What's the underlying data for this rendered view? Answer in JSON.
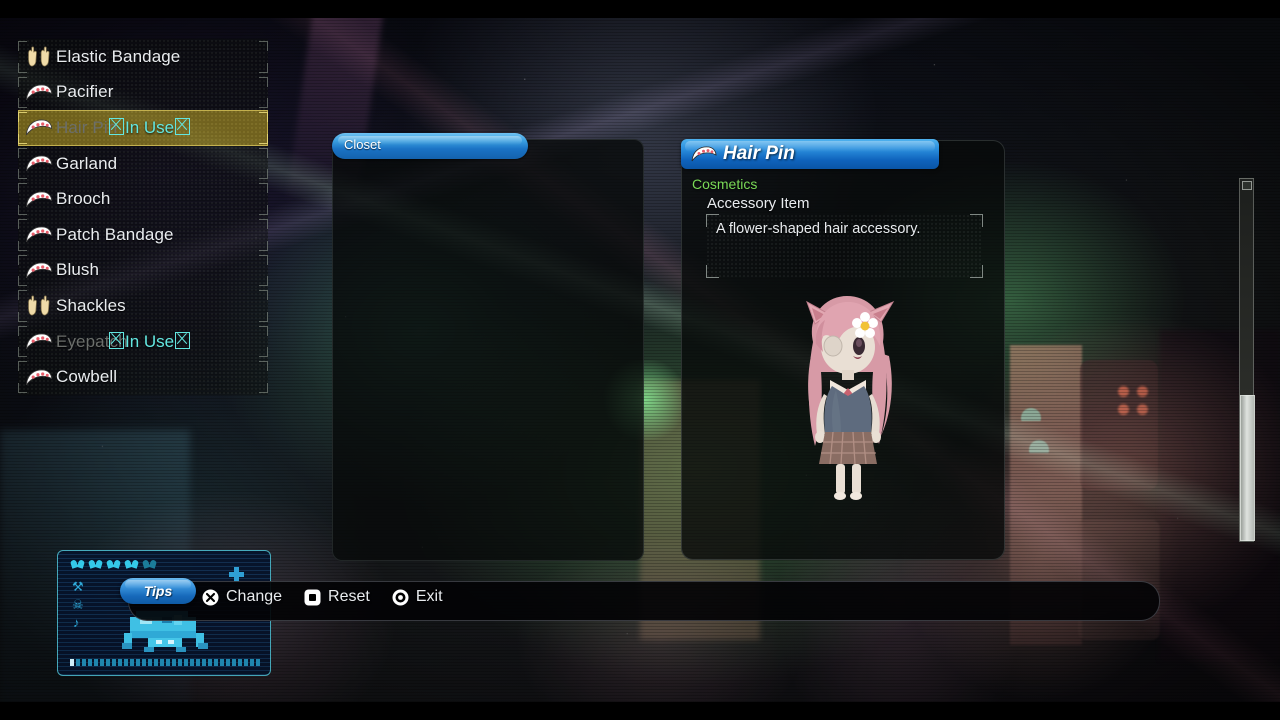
{
  "closet": {
    "tab_label": "Closet",
    "items": [
      {
        "label": "Elastic Bandage",
        "icon": "gloves-icon",
        "in_use": false,
        "selected": false
      },
      {
        "label": "Pacifier",
        "icon": "headwear-icon",
        "in_use": false,
        "selected": false
      },
      {
        "label": "Hair Pin",
        "icon": "headwear-icon",
        "in_use": true,
        "in_use_label": "In Use",
        "selected": true
      },
      {
        "label": "Garland",
        "icon": "headwear-icon",
        "in_use": false,
        "selected": false
      },
      {
        "label": "Brooch",
        "icon": "headwear-icon",
        "in_use": false,
        "selected": false
      },
      {
        "label": "Patch Bandage",
        "icon": "headwear-icon",
        "in_use": false,
        "selected": false
      },
      {
        "label": "Blush",
        "icon": "headwear-icon",
        "in_use": false,
        "selected": false
      },
      {
        "label": "Shackles",
        "icon": "gloves-icon",
        "in_use": false,
        "selected": false
      },
      {
        "label": "Eyepatch",
        "icon": "headwear-icon",
        "in_use": true,
        "in_use_label": "In Use",
        "selected": false
      },
      {
        "label": "Cowbell",
        "icon": "headwear-icon",
        "in_use": false,
        "selected": false
      }
    ]
  },
  "detail": {
    "title": "Hair Pin",
    "title_icon": "headwear-icon",
    "category": "Cosmetics",
    "subtype": "Accessory Item",
    "description": "A flower-shaped hair accessory.",
    "category_color": "#7ad957",
    "header_color": "#1a72c4"
  },
  "bottom_bar": {
    "tips_label": "Tips",
    "commands": [
      {
        "icon": "button-x-icon",
        "label": "Change"
      },
      {
        "icon": "button-square-icon",
        "label": "Reset"
      },
      {
        "icon": "button-circle-icon",
        "label": "Exit"
      }
    ]
  },
  "hud": {
    "hearts": 5,
    "accent_color": "#34c9e8"
  }
}
